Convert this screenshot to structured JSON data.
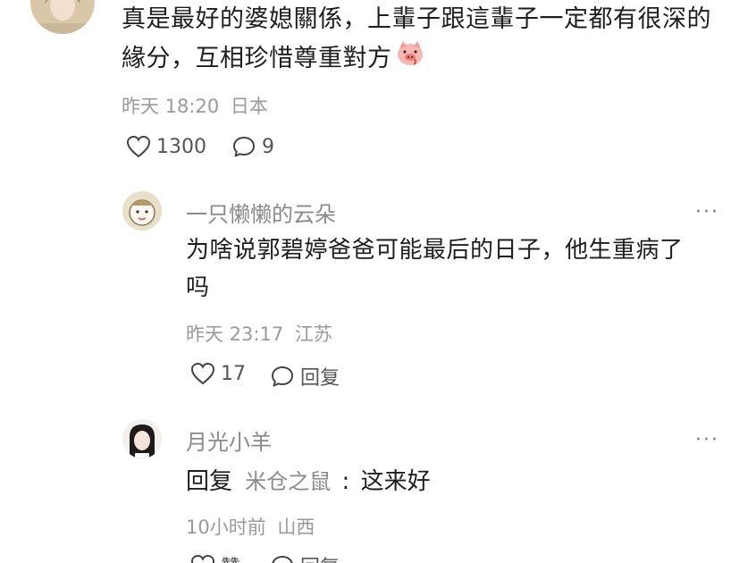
{
  "comment": {
    "text_line1": "真是最好的婆媳關係，上輩子跟這輩子一定都有很深的",
    "text_line2": "緣分，互相珍惜尊重對方",
    "emoji": "pig-face-icon",
    "time": "昨天 18:20",
    "location": "日本",
    "likes": "1300",
    "replies": "9"
  },
  "reply1": {
    "username": "一只懒懒的云朵",
    "text_line1": "为啥说郭碧婷爸爸可能最后的日子，他生重病了",
    "text_line2": "吗",
    "time": "昨天 23:17",
    "location": "江苏",
    "likes": "17",
    "reply_label": "回复",
    "more": "···"
  },
  "reply2": {
    "username": "月光小羊",
    "reply_prefix": "回复",
    "mention": "米仓之鼠",
    "separator": ":",
    "text": "这来好",
    "time": "10小时前",
    "location": "山西",
    "likes": "赞",
    "reply_label": "回复",
    "more": "···"
  },
  "colors": {
    "text": "#1e1e1e",
    "muted": "#9a9a9a",
    "username": "#8a8a8a"
  }
}
